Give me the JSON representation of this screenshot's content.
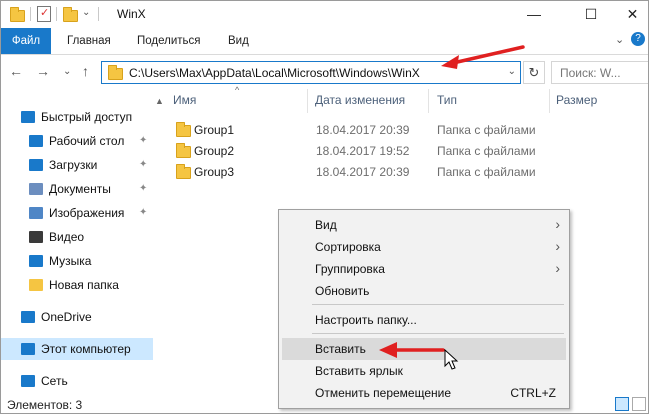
{
  "window": {
    "title": "WinX",
    "controls": {
      "minimize": "—",
      "maximize": "☐",
      "close": "✕"
    }
  },
  "ribbon": {
    "tabs": [
      "Файл",
      "Главная",
      "Поделиться",
      "Вид"
    ],
    "expand": "⌄",
    "help": "?"
  },
  "nav": {
    "back": "←",
    "forward": "→",
    "recent": "⌄",
    "up": "↑",
    "address": "C:\\Users\\Max\\AppData\\Local\\Microsoft\\Windows\\WinX",
    "address_dropdown": "⌄",
    "refresh": "↻",
    "search_placeholder": "Поиск: W..."
  },
  "sidebar": {
    "items": [
      {
        "label": "Быстрый доступ",
        "icon": "star-icon",
        "color": "#1979ca"
      },
      {
        "label": "Рабочий стол",
        "icon": "desktop-icon",
        "color": "#1979ca",
        "pinned": true
      },
      {
        "label": "Загрузки",
        "icon": "downloads-icon",
        "color": "#1979ca",
        "pinned": true
      },
      {
        "label": "Документы",
        "icon": "documents-icon",
        "color": "#6c8ebf",
        "pinned": true
      },
      {
        "label": "Изображения",
        "icon": "pictures-icon",
        "color": "#4f86c6",
        "pinned": true
      },
      {
        "label": "Видео",
        "icon": "video-icon",
        "color": "#3a3a3a"
      },
      {
        "label": "Музыка",
        "icon": "music-icon",
        "color": "#1979ca"
      },
      {
        "label": "Новая папка",
        "icon": "folder-icon",
        "color": "#f5c542"
      },
      {
        "label": "OneDrive",
        "icon": "onedrive-icon",
        "color": "#1979ca"
      },
      {
        "label": "Этот компьютер",
        "icon": "computer-icon",
        "color": "#1979ca",
        "selected": true
      },
      {
        "label": "Сеть",
        "icon": "network-icon",
        "color": "#1979ca"
      }
    ],
    "pin_glyph": "✦"
  },
  "columns": [
    "Имя",
    "Дата изменения",
    "Тип",
    "Размер"
  ],
  "files": [
    {
      "name": "Group1",
      "date": "18.04.2017 20:39",
      "type": "Папка с файлами"
    },
    {
      "name": "Group2",
      "date": "18.04.2017 19:52",
      "type": "Папка с файлами"
    },
    {
      "name": "Group3",
      "date": "18.04.2017 20:39",
      "type": "Папка с файлами"
    }
  ],
  "context_menu": {
    "view": "Вид",
    "sort": "Сортировка",
    "group": "Группировка",
    "refresh": "Обновить",
    "customize": "Настроить папку...",
    "paste": "Вставить",
    "paste_shortcut": "Вставить ярлык",
    "undo_move": "Отменить перемещение",
    "undo_shortcut": "CTRL+Z",
    "submenu_glyph": "›"
  },
  "status": {
    "items": "Элементов: 3"
  },
  "colors": {
    "accent": "#1979ca",
    "selection": "#cce8ff",
    "annotation_arrow": "#e02020"
  }
}
